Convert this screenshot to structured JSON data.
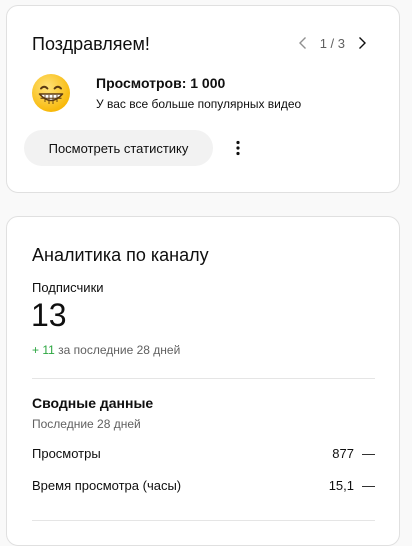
{
  "congrats": {
    "title": "Поздравляем!",
    "pager": "1 / 3",
    "icon": "grinning-face-emoji",
    "message_title": "Просмотров: 1 000",
    "message_subtitle": "У вас все больше популярных видео",
    "stats_button": "Посмотреть статистику"
  },
  "analytics": {
    "title": "Аналитика по каналу",
    "subscribers_label": "Подписчики",
    "subscribers_value": "13",
    "subscribers_delta": "+ 11",
    "subscribers_period": "за последние 28 дней",
    "summary_title": "Сводные данные",
    "summary_period": "Последние 28 дней",
    "rows": [
      {
        "label": "Просмотры",
        "value": "877",
        "trend": "—"
      },
      {
        "label": "Время просмотра (часы)",
        "value": "15,1",
        "trend": "—"
      }
    ]
  },
  "colors": {
    "positive": "#2ba640",
    "secondary_text": "#606060",
    "button_bg": "#f2f2f2"
  }
}
